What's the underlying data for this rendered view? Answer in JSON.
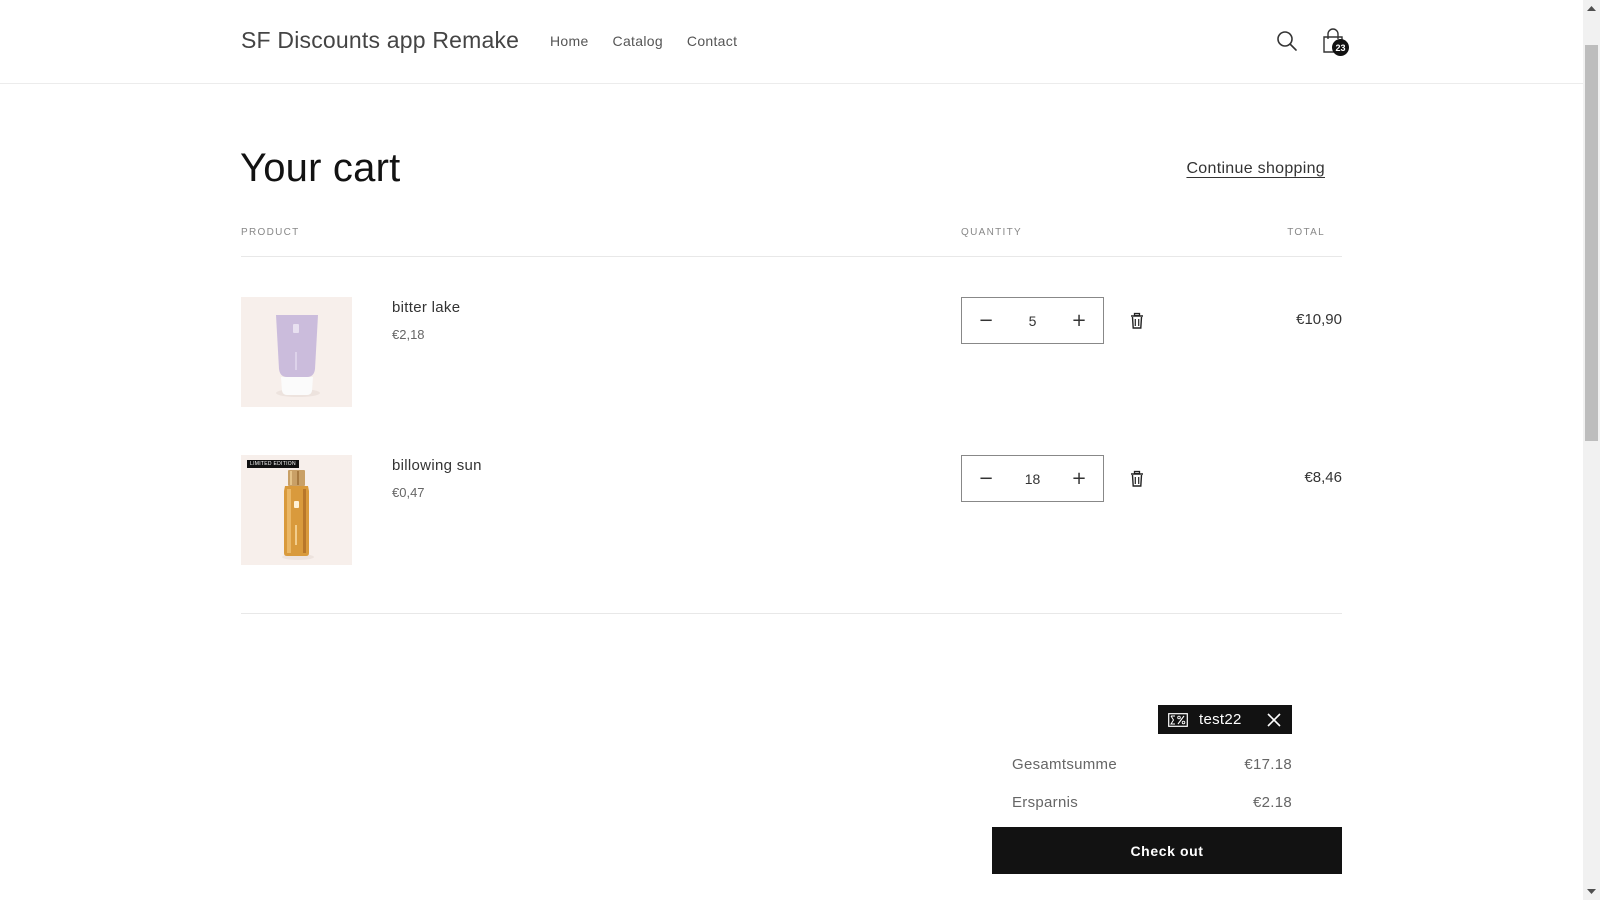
{
  "header": {
    "logo": "SF Discounts app Remake",
    "nav": [
      {
        "label": "Home"
      },
      {
        "label": "Catalog"
      },
      {
        "label": "Contact"
      }
    ],
    "search_icon": "search-icon",
    "cart_icon": "shopping-bag-icon",
    "cart_count": "23"
  },
  "cart": {
    "title": "Your cart",
    "continue_label": "Continue shopping",
    "columns": {
      "product": "PRODUCT",
      "quantity": "QUANTITY",
      "total": "TOTAL"
    },
    "items": [
      {
        "name": "bitter lake",
        "price": "€2,18",
        "quantity": "5",
        "total": "€10,90",
        "image": "lavender-tube-product-image"
      },
      {
        "name": "billowing sun",
        "price": "€0,47",
        "quantity": "18",
        "total": "€8,46",
        "image": "gold-bottle-product-image",
        "badge": "LIMITED EDITION"
      }
    ],
    "decrease_symbol": "−",
    "increase_symbol": "+",
    "remove_icon": "trash-icon"
  },
  "discount": {
    "icon": "discount-tag-icon",
    "code": "test22",
    "remove_icon": "close-icon"
  },
  "summary": {
    "subtotal_label": "Gesamtsumme",
    "subtotal_value": "€17.18",
    "savings_label": "Ersparnis",
    "savings_value": "€2.18"
  },
  "checkout_label": "Check out",
  "colors": {
    "primary": "#121212",
    "thumb_background": "#f7efeb",
    "border": "#888888"
  }
}
